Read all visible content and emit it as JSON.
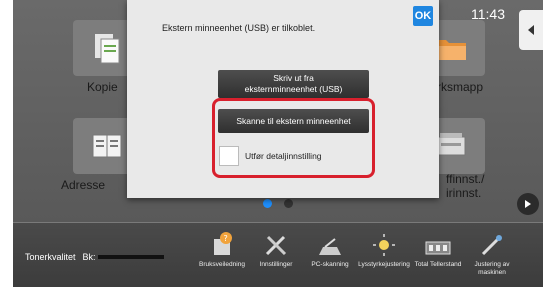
{
  "clock": "11:43",
  "dialog": {
    "message": "Ekstern minneenhet (USB) er tilkoblet.",
    "ok_label": "OK",
    "print_button": "Skriv ut fra eksternminneenhet (USB)",
    "scan_button": "Skanne til ekstern minneenhet",
    "detail_checkbox_label": "Utfør detaljinnstilling",
    "detail_checked": false
  },
  "tiles": {
    "copy": "Kopie",
    "fileshare": "rksmapp",
    "address": "Adresse",
    "settings_line1": "ffinnst./",
    "settings_line2": "irinnst."
  },
  "toner": {
    "label": "Tonerkvalitet",
    "color_label": "Bk"
  },
  "bottom_bar": [
    {
      "label": "Bruksveiledning",
      "icon": "user-guide-icon"
    },
    {
      "label": "Innstillinger",
      "icon": "tools-icon"
    },
    {
      "label": "PC-skanning",
      "icon": "scanner-icon"
    },
    {
      "label": "Lysstyrkejustering",
      "icon": "brightness-icon"
    },
    {
      "label": "Total Tellerstand",
      "icon": "counter-icon"
    },
    {
      "label": "Justering av maskinen",
      "icon": "machine-adjust-icon"
    }
  ],
  "pager": {
    "pages": 2,
    "active_index": 0
  },
  "colors": {
    "accent": "#1f86e0",
    "highlight": "#d8202d"
  }
}
